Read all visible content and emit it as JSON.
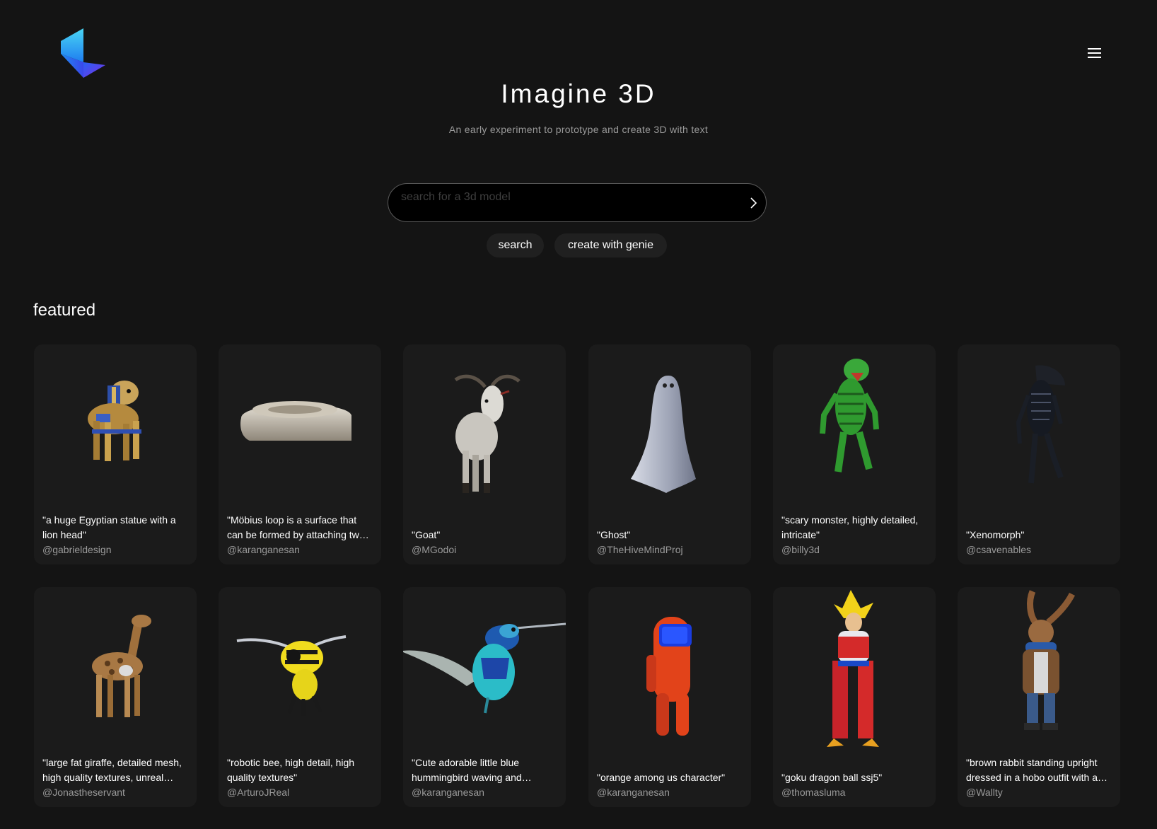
{
  "header": {
    "logo_name": "imagine-3d-logo",
    "menu_icon": "hamburger-menu-icon"
  },
  "hero": {
    "title": "Imagine 3D",
    "subtitle": "An early experiment to prototype and create 3D with text"
  },
  "search": {
    "placeholder": "search for a 3d model",
    "value": "",
    "submit_icon": "chevron-right-icon"
  },
  "actions": {
    "search_label": "search",
    "genie_label": "create with genie"
  },
  "featured": {
    "title": "featured",
    "items": [
      {
        "caption": "\"a huge Egyptian statue with a lion head\"",
        "author": "@gabrieldesign",
        "thumb": "egyptian-lion-statue"
      },
      {
        "caption": "\"Möbius loop is a surface that can be formed by attaching two ends of a strip\"",
        "author": "@karanganesan",
        "thumb": "mobius-loop"
      },
      {
        "caption": "\"Goat\"",
        "author": "@MGodoi",
        "thumb": "goat"
      },
      {
        "caption": "\"Ghost\"",
        "author": "@TheHiveMindProj",
        "thumb": "ghost"
      },
      {
        "caption": "\"scary monster, highly detailed, intricate\"",
        "author": "@billy3d",
        "thumb": "green-monster"
      },
      {
        "caption": "\"Xenomorph\"",
        "author": "@csavenables",
        "thumb": "xenomorph"
      },
      {
        "caption": "\"large fat giraffe, detailed mesh, high quality textures, unreal engine\"",
        "author": "@Jonastheservant",
        "thumb": "giraffe"
      },
      {
        "caption": "\"robotic bee, high detail, high quality textures\"",
        "author": "@ArturoJReal",
        "thumb": "robotic-bee"
      },
      {
        "caption": "\"Cute adorable little blue hummingbird waving and smiling\"",
        "author": "@karanganesan",
        "thumb": "hummingbird"
      },
      {
        "caption": "\"orange among us character\"",
        "author": "@karanganesan",
        "thumb": "among-us-character"
      },
      {
        "caption": "\"goku dragon ball ssj5\"",
        "author": "@thomasluma",
        "thumb": "goku"
      },
      {
        "caption": "\"brown rabbit standing upright dressed in a hobo outfit with a scarf\"",
        "author": "@Wallty",
        "thumb": "brown-rabbit"
      }
    ]
  },
  "colors": {
    "background": "#141414",
    "card": "#1b1b1b",
    "pill": "#202020",
    "muted_text": "#9a9a9a",
    "logo_cyan": "#3fd0f2",
    "logo_blue": "#2a5cf0",
    "logo_purple": "#7a32e8"
  }
}
